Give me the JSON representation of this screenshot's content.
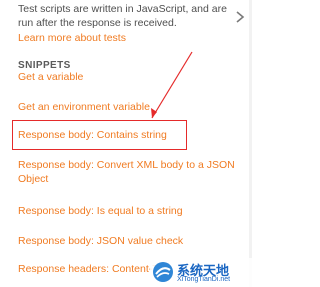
{
  "panel": {
    "description": "Test scripts are written in JavaScript, and are run after the response is received.",
    "learn_more": "Learn more about tests",
    "collapse_icon": "chevron-right-icon",
    "snippets_heading": "SNIPPETS"
  },
  "snippets": [
    "Get a variable",
    "Get an environment variable",
    "Response body: Contains string",
    "Response body: Convert XML body to a JSON Object",
    "Response body: Is equal to a string",
    "Response body: JSON value check",
    "Response headers: Content-Type header check"
  ],
  "annotation": {
    "highlight_color": "#e52a2a",
    "highlighted_snippet": "Response body: Contains string"
  },
  "watermark": {
    "title": "系统天地",
    "url": "XiTongTianDi.net"
  },
  "colors": {
    "link": "#f07b22",
    "text": "#4f4f4f",
    "watermark": "#1a66c2"
  }
}
